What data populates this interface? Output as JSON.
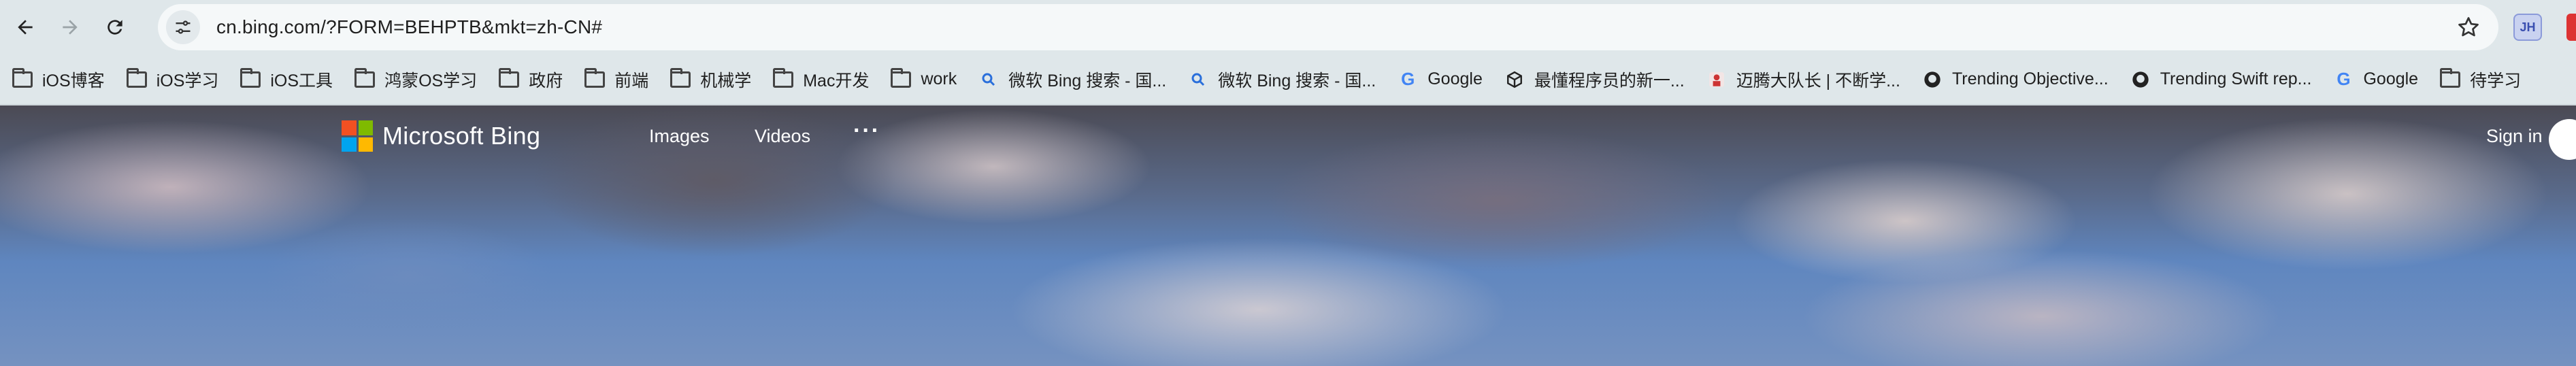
{
  "browser": {
    "url": "cn.bing.com/?FORM=BEHPTB&mkt=zh-CN#",
    "extension_badge": "JH"
  },
  "bookmarks": [
    {
      "label": "iOS博客",
      "icon": "folder-icon"
    },
    {
      "label": "iOS学习",
      "icon": "folder-icon"
    },
    {
      "label": "iOS工具",
      "icon": "folder-icon"
    },
    {
      "label": "鸿蒙OS学习",
      "icon": "folder-icon"
    },
    {
      "label": "政府",
      "icon": "folder-icon"
    },
    {
      "label": "前端",
      "icon": "folder-icon"
    },
    {
      "label": "机械学",
      "icon": "folder-icon"
    },
    {
      "label": "Mac开发",
      "icon": "folder-icon"
    },
    {
      "label": "work",
      "icon": "folder-icon"
    },
    {
      "label": "微软 Bing 搜索 - 国...",
      "icon": "search-icon"
    },
    {
      "label": "微软 Bing 搜索 - 国...",
      "icon": "search-icon"
    },
    {
      "label": "Google",
      "icon": "google-icon"
    },
    {
      "label": "最懂程序员的新一...",
      "icon": "cube-icon"
    },
    {
      "label": "迈腾大队长 | 不断学...",
      "icon": "avatar-icon"
    },
    {
      "label": "Trending Objective...",
      "icon": "github-icon"
    },
    {
      "label": "Trending Swift rep...",
      "icon": "github-icon"
    },
    {
      "label": "Google",
      "icon": "google-icon"
    },
    {
      "label": "待学习",
      "icon": "folder-icon"
    }
  ],
  "bing": {
    "logo_text": "Microsoft Bing",
    "nav": {
      "images": "Images",
      "videos": "Videos",
      "more": "···"
    },
    "sign_in": "Sign in",
    "logo_colors": [
      "#f25022",
      "#7fba00",
      "#00a4ef",
      "#ffb900"
    ]
  }
}
